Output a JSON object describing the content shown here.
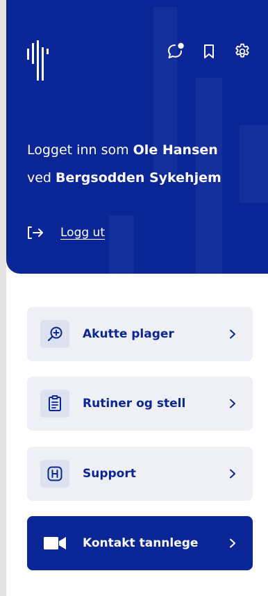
{
  "colors": {
    "brand": "#0a2596",
    "card_bg": "#eef0f6",
    "icon_bg": "#dde2f0",
    "page_side": "#e3e3e3"
  },
  "header": {
    "logo_icon": "app-logo",
    "icons": [
      "chat-notification-icon",
      "bookmark-icon",
      "settings-gear-icon"
    ],
    "greeting": {
      "prefix": "Logget inn som ",
      "user_name": "Ole Hansen",
      "connector": "ved ",
      "facility": "Bergsodden Sykehjem"
    },
    "logout_label": "Logg ut"
  },
  "menu": [
    {
      "label": "Akutte plager",
      "icon": "search-plus-icon"
    },
    {
      "label": "Rutiner og stell",
      "icon": "clipboard-icon"
    },
    {
      "label": "Support",
      "icon": "help-h-icon"
    },
    {
      "label": "Kontakt tannlege",
      "icon": "video-camera-icon"
    }
  ]
}
